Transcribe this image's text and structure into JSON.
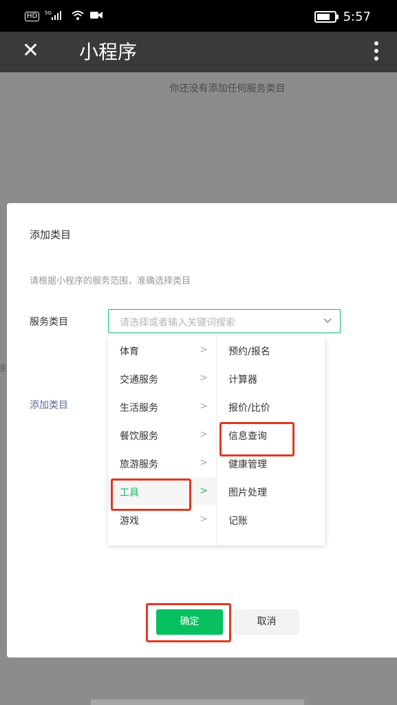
{
  "status_bar": {
    "hd": "HD",
    "signal": "5G",
    "time": "5:57",
    "battery_level": 0.9
  },
  "header": {
    "close_icon": "close-icon",
    "title": "小程序",
    "more_icon": "more-vertical-icon"
  },
  "background": {
    "empty_message": "你还没有添加任何服务类目",
    "edge_char": "别"
  },
  "dialog": {
    "title": "添加类目",
    "hint": "请根据小程序的服务范围，准确选择类目",
    "field_label": "服务类目",
    "select_placeholder": "请选择或者输入关键词搜索",
    "add_link": "添加类目",
    "ok_label": "确定",
    "cancel_label": "取消"
  },
  "menu": {
    "categories": [
      {
        "label": "体育"
      },
      {
        "label": "交通服务"
      },
      {
        "label": "生活服务"
      },
      {
        "label": "餐饮服务"
      },
      {
        "label": "旅游服务"
      },
      {
        "label": "工具"
      },
      {
        "label": "游戏"
      }
    ],
    "arrow": ">",
    "selected_category": "工具",
    "subcategories": [
      {
        "label": "预约/报名"
      },
      {
        "label": "计算器"
      },
      {
        "label": "报价/比价"
      },
      {
        "label": "信息查询"
      },
      {
        "label": "健康管理"
      },
      {
        "label": "图片处理"
      },
      {
        "label": "记账"
      }
    ]
  },
  "colors": {
    "accent_green": "#07c160",
    "highlight_red": "#e0391f",
    "link_blue": "#576b95"
  }
}
